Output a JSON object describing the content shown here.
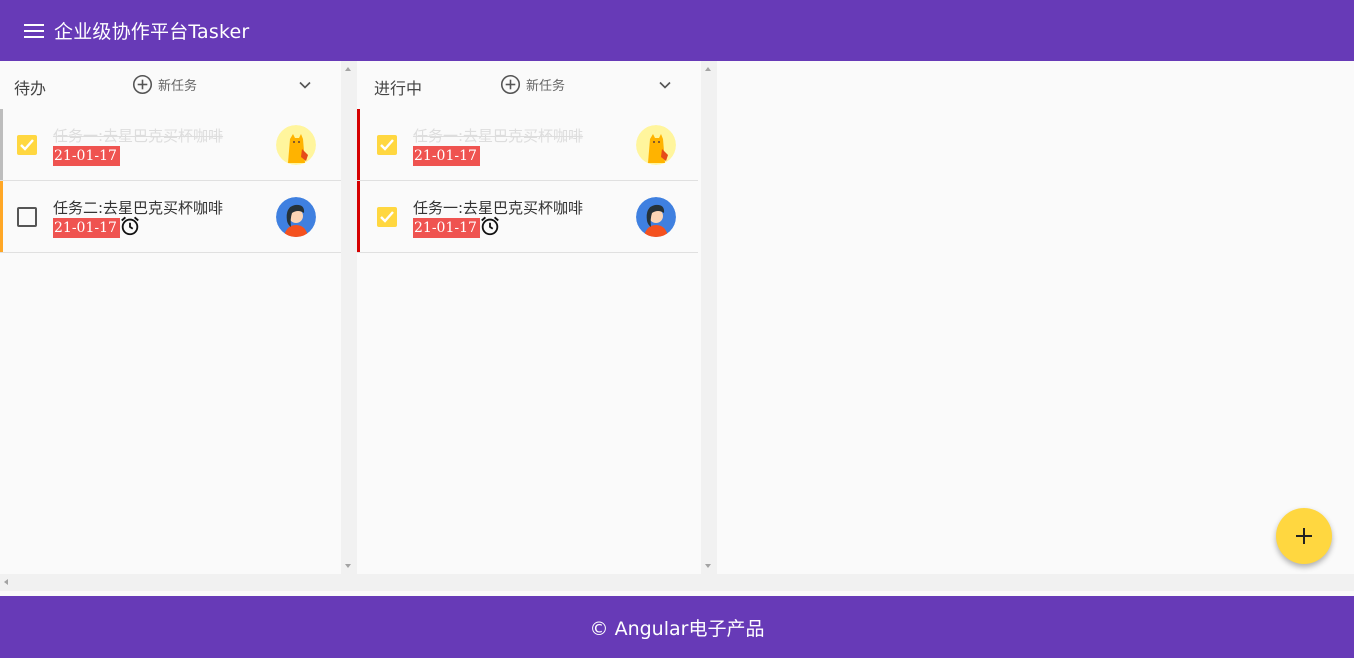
{
  "app": {
    "title": "企业级协作平台Tasker",
    "menu_icon": "menu-icon",
    "footer": "© Angular电子产品",
    "colors": {
      "primary": "#673ab7",
      "accent": "#ffd740",
      "date_badge": "#ef5350",
      "priority_orange": "#ffa726",
      "priority_red": "#d50000",
      "priority_grey": "#bdbdbd"
    }
  },
  "lists": [
    {
      "name": "待办",
      "new_task_label": "新任务",
      "tasks": [
        {
          "desc": "任务一:去星巴克买杯咖啡",
          "date": "21-01-17",
          "completed": true,
          "has_reminder": false,
          "avatar": "cat-avatar",
          "priority": "grey"
        },
        {
          "desc": "任务二:去星巴克买杯咖啡",
          "date": "21-01-17",
          "completed": false,
          "has_reminder": true,
          "avatar": "girl-avatar",
          "priority": "orange"
        }
      ]
    },
    {
      "name": "进行中",
      "new_task_label": "新任务",
      "tasks": [
        {
          "desc": "任务一:去星巴克买杯咖啡",
          "date": "21-01-17",
          "completed": true,
          "has_reminder": false,
          "avatar": "cat-avatar",
          "priority": "red"
        },
        {
          "desc": "任务一:去星巴克买杯咖啡",
          "date": "21-01-17",
          "completed": true,
          "has_reminder": true,
          "avatar": "girl-avatar",
          "priority": "red"
        }
      ]
    }
  ]
}
